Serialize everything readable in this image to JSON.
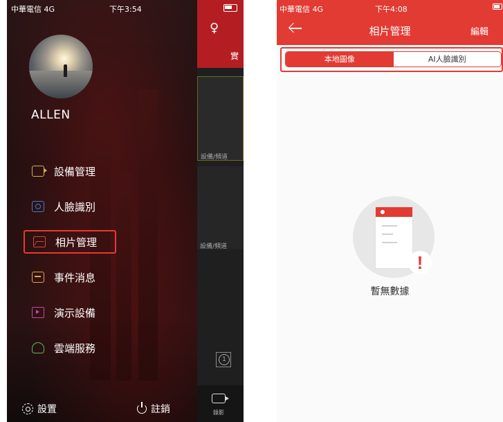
{
  "left_phone": {
    "status": {
      "carrier": "中華電信  4G",
      "time": "下午3:54"
    },
    "username": "ALLEN",
    "menu": [
      {
        "label": "設備管理",
        "icon": "camera-icon"
      },
      {
        "label": "人臉識別",
        "icon": "face-recognition-icon"
      },
      {
        "label": "相片管理",
        "icon": "photo-icon",
        "highlighted": true
      },
      {
        "label": "事件消息",
        "icon": "message-icon"
      },
      {
        "label": "演示設備",
        "icon": "demo-play-icon"
      },
      {
        "label": "雲端服務",
        "icon": "cloud-icon"
      }
    ],
    "bottom": {
      "settings": "設置",
      "logout": "註銷"
    },
    "background_strip": {
      "tab_partial": "實",
      "channel_label_1": "設備/頻道",
      "channel_label_2": "設備/頻道",
      "clock_digit": "1",
      "record_label": "錄影"
    }
  },
  "right_phone": {
    "status": {
      "carrier": "中華電信  4G",
      "time": "下午4:08"
    },
    "title": "相片管理",
    "edit": "編輯",
    "tabs": [
      {
        "label": "本地圖像",
        "active": true
      },
      {
        "label": "AI人臉識別",
        "active": false
      }
    ],
    "empty_message": "暫無數據"
  },
  "colors": {
    "accent_red": "#e23b33",
    "highlight_border": "#e53a32"
  }
}
